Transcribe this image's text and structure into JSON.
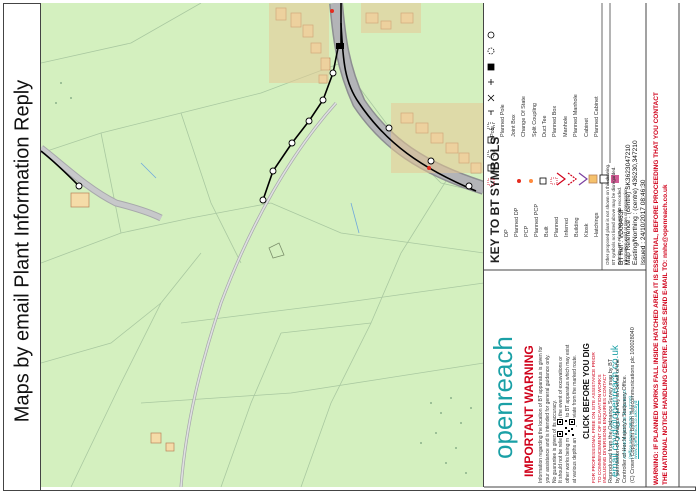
{
  "title": "Maps by email Plant Information Reply",
  "warning": {
    "heading": "IMPORTANT WARNING",
    "lines": [
      "Information regarding the location of BT apparatus is given for",
      "your assistance and is intended for general guidance only.",
      "No guarantee is given of its accuracy.",
      "It should not be relied upon in the event of excavations or",
      "other works being made near to BT apparatus which may exist",
      "at various depths and may deviate from the marked route."
    ],
    "click_before_you_dig": "CLICK BEFORE YOU DIG",
    "professional_lines": [
      "FOR PROFESSIONAL FREE ON SITE ASSISTANCE PRIOR",
      "TO COMMENCEMENT OF EXCAVATION WORKS",
      "INCLUDING DIVERSIONS ENQUIRIES CONTACT"
    ],
    "email": "email cbyd@openreach.co.uk",
    "advance_notice": "ADVANCE NOTICE REQUIRED",
    "office_hours": "(Office Hours: 08:00 to 17:00)",
    "website": "www.openreach.co.uk/cbyd",
    "brand": "openreach",
    "copyright_lines": [
      "Reproduced from the Ordnance Survey map by BT",
      "by permission of Ordnance Survey on behalf of the",
      "Controller of Her Majesty's Stationery Office.",
      "(C) Crown Copyright British Telecommunications plc 100028040"
    ]
  },
  "key": {
    "heading": "KEY TO BT SYMBOLS",
    "col1": [
      "Pole",
      "Planned Pole",
      "Joint Box",
      "Change Of State",
      "Split Coupling",
      "Duct Tee",
      "Planned Box",
      "Manhole",
      "Planned Manhole",
      "Cabinet",
      "Planned Cabinet"
    ],
    "col2": [
      "DP",
      "Planned DP",
      "PCP",
      "Planned PCP",
      "Built",
      "Planned",
      "Inferred",
      "Building",
      "Kiosk",
      "Hatchings"
    ],
    "note_lines": [
      "Other proposed plant is not shown on this drawing.",
      "BT symbols not listed above may be disregarded.",
      "Existing BT Plant may not be recorded.",
      "Information valid at time of preparation."
    ],
    "details": {
      "ref": "BT Ref : VD08463F",
      "map_ref": "Map Reference : (centre) SK3623047210",
      "easting": "Easting/Northing : (centre) 436230,347210",
      "issued": "Issued : 24/10/2017 08:46:30"
    }
  },
  "bottom_warning": [
    "WARNING: IF PLANNED WORKS FALL INSIDE HATCHED AREA IT IS ESSENTIAL, BEFORE PROCEEDING THAT YOU CONTACT",
    "THE NATIONAL NOTICE HANDLING CENTRE. PLEASE SEND E-MAIL TO: nnhc@openreach.co.uk"
  ],
  "colors": {
    "field": "#d4f0bf",
    "boundary": "#a9c8a0",
    "building": "#f5dca8",
    "road": "#a7a8ab",
    "cable": "#000000",
    "warning_red": "#d0021b",
    "openreach_teal": "#1aa0a6"
  }
}
